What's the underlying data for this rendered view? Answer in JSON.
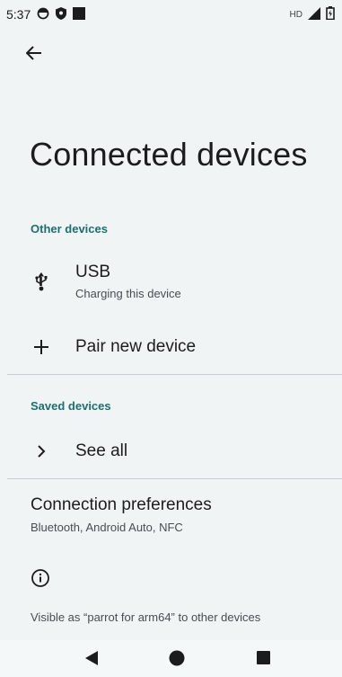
{
  "status_bar": {
    "time": "5:37",
    "network_label": "HD",
    "icons": [
      "clock-icon",
      "shield-icon",
      "square-icon",
      "signal-icon",
      "battery-icon"
    ]
  },
  "header": {
    "back_icon": "arrow-left-icon",
    "title": "Connected devices"
  },
  "other_devices": {
    "header": "Other devices",
    "usb": {
      "icon": "usb-icon",
      "title": "USB",
      "subtitle": "Charging this device"
    },
    "pair": {
      "icon": "plus-icon",
      "title": "Pair new device"
    }
  },
  "saved_devices": {
    "header": "Saved devices",
    "see_all": {
      "icon": "chevron-right-icon",
      "title": "See all"
    }
  },
  "connection_preferences": {
    "title": "Connection preferences",
    "subtitle": "Bluetooth, Android Auto, NFC"
  },
  "footer": {
    "info_icon": "info-icon",
    "text": "Visible as “parrot for arm64” to other devices"
  },
  "nav_bar": {
    "icons": [
      "back-triangle-icon",
      "home-circle-icon",
      "recents-square-icon"
    ]
  },
  "colors": {
    "background": "#f0f4f5",
    "accent": "#1f6e6e",
    "text_primary": "#1b1c1d",
    "text_secondary": "#4a4d4f"
  }
}
